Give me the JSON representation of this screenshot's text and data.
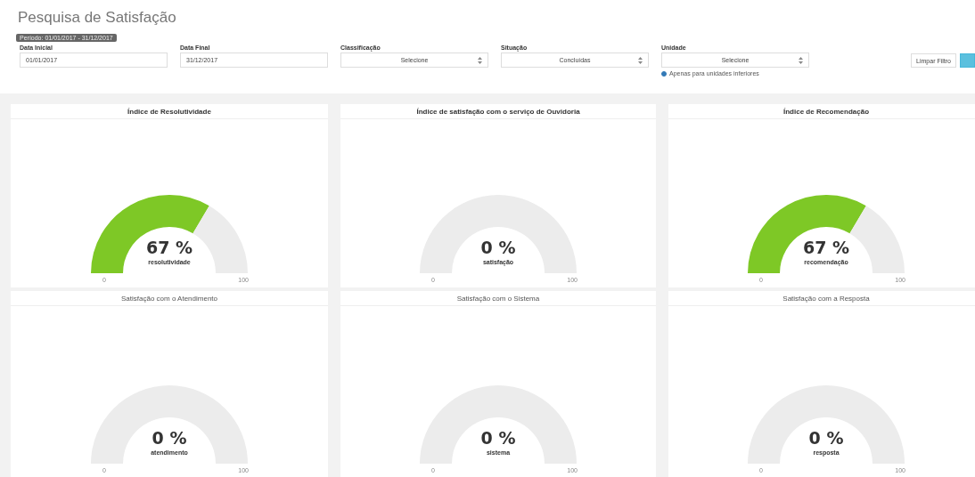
{
  "title": "Pesquisa de Satisfação",
  "period_badge": "Período: 01/01/2017 - 31/12/2017",
  "filters": [
    {
      "kind": "input",
      "label": "Data Inicial",
      "value": "01/01/2017"
    },
    {
      "kind": "input",
      "label": "Data Final",
      "value": "31/12/2017"
    },
    {
      "kind": "select",
      "label": "Classificação",
      "value": "Selecione"
    },
    {
      "kind": "select",
      "label": "Situação",
      "value": "Concluídas"
    },
    {
      "kind": "select",
      "label": "Unidade",
      "value": "Selecione",
      "checkbox": {
        "label": "Apenas para unidades inferiores",
        "checked": true
      }
    }
  ],
  "buttons": [
    {
      "kind": "plain",
      "label": "Limpar Filtro"
    },
    {
      "kind": "primary"
    }
  ],
  "cards": [
    {
      "title": "Índice de Resolutividade",
      "kind": "index",
      "value": "67 %",
      "caption": "resolutividade",
      "min": "0",
      "max": "100"
    },
    {
      "title": "Índice de satisfação com o serviço de Ouvidoria",
      "kind": "index",
      "value": "0 %",
      "caption": "satisfação",
      "min": "0",
      "max": "100"
    },
    {
      "title": "Índice de Recomendação",
      "kind": "index",
      "value": "67 %",
      "caption": "recomendação",
      "min": "0",
      "max": "100"
    },
    {
      "title": "Satisfação com o Atendimento",
      "kind": "rating",
      "value": "0 %",
      "caption": "atendimento",
      "min": "0",
      "max": "100"
    },
    {
      "title": "Satisfação com o Sistema",
      "kind": "rating",
      "value": "0 %",
      "caption": "sistema",
      "min": "0",
      "max": "100"
    },
    {
      "title": "Satisfação com a Resposta",
      "kind": "rating",
      "value": "0 %",
      "caption": "resposta",
      "min": "0",
      "max": "100"
    }
  ]
}
